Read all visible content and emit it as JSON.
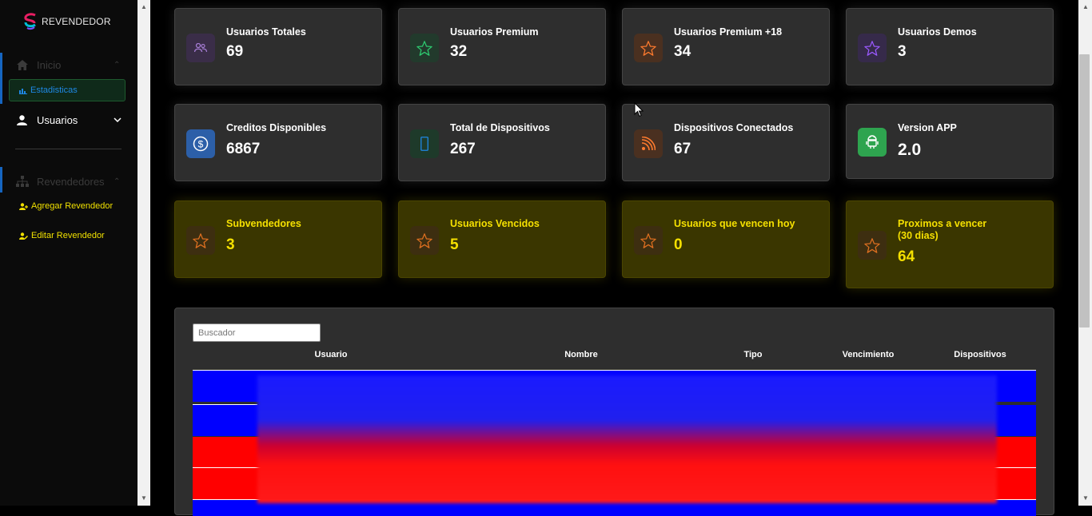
{
  "brand": {
    "name": "REVENDEDOR"
  },
  "sidebar": {
    "inicio": "Inicio",
    "estadisticas": "Estadisticas",
    "usuarios": "Usuarios",
    "revendedores": "Revendedores",
    "agregar": "Agregar Revendedor",
    "editar": "Editar Revendedor"
  },
  "cards": [
    {
      "label": "Usuarios Totales",
      "value": "69",
      "icon": "users-icon"
    },
    {
      "label": "Usuarios Premium",
      "value": "32",
      "icon": "star-icon"
    },
    {
      "label": "Usuarios Premium +18",
      "value": "34",
      "icon": "star-icon"
    },
    {
      "label": "Usuarios Demos",
      "value": "3",
      "icon": "star-icon"
    },
    {
      "label": "Creditos Disponibles",
      "value": "6867",
      "icon": "dollar-icon"
    },
    {
      "label": "Total de Dispositivos",
      "value": "267",
      "icon": "phone-icon"
    },
    {
      "label": "Dispositivos Conectados",
      "value": "67",
      "icon": "rss-icon"
    },
    {
      "label": "Version APP",
      "value": "2.0",
      "icon": "android-icon"
    },
    {
      "label": "Subvendedores",
      "value": "3",
      "icon": "star-icon"
    },
    {
      "label": "Usuarios Vencidos",
      "value": "5",
      "icon": "star-icon"
    },
    {
      "label": "Usuarios que vencen hoy",
      "value": "0",
      "icon": "star-icon"
    },
    {
      "label": "Proximos a vencer\n(30 dias)",
      "value": "64",
      "icon": "star-icon"
    }
  ],
  "table": {
    "search_placeholder": "Buscador",
    "columns": [
      "Usuario",
      "Nombre",
      "Tipo",
      "Vencimiento",
      "Dispositivos"
    ]
  },
  "colors": {
    "accent_blue": "#1565c0",
    "highlight_yellow": "#f5e000",
    "row_blue": "#0000ff",
    "row_red": "#ff0000"
  }
}
